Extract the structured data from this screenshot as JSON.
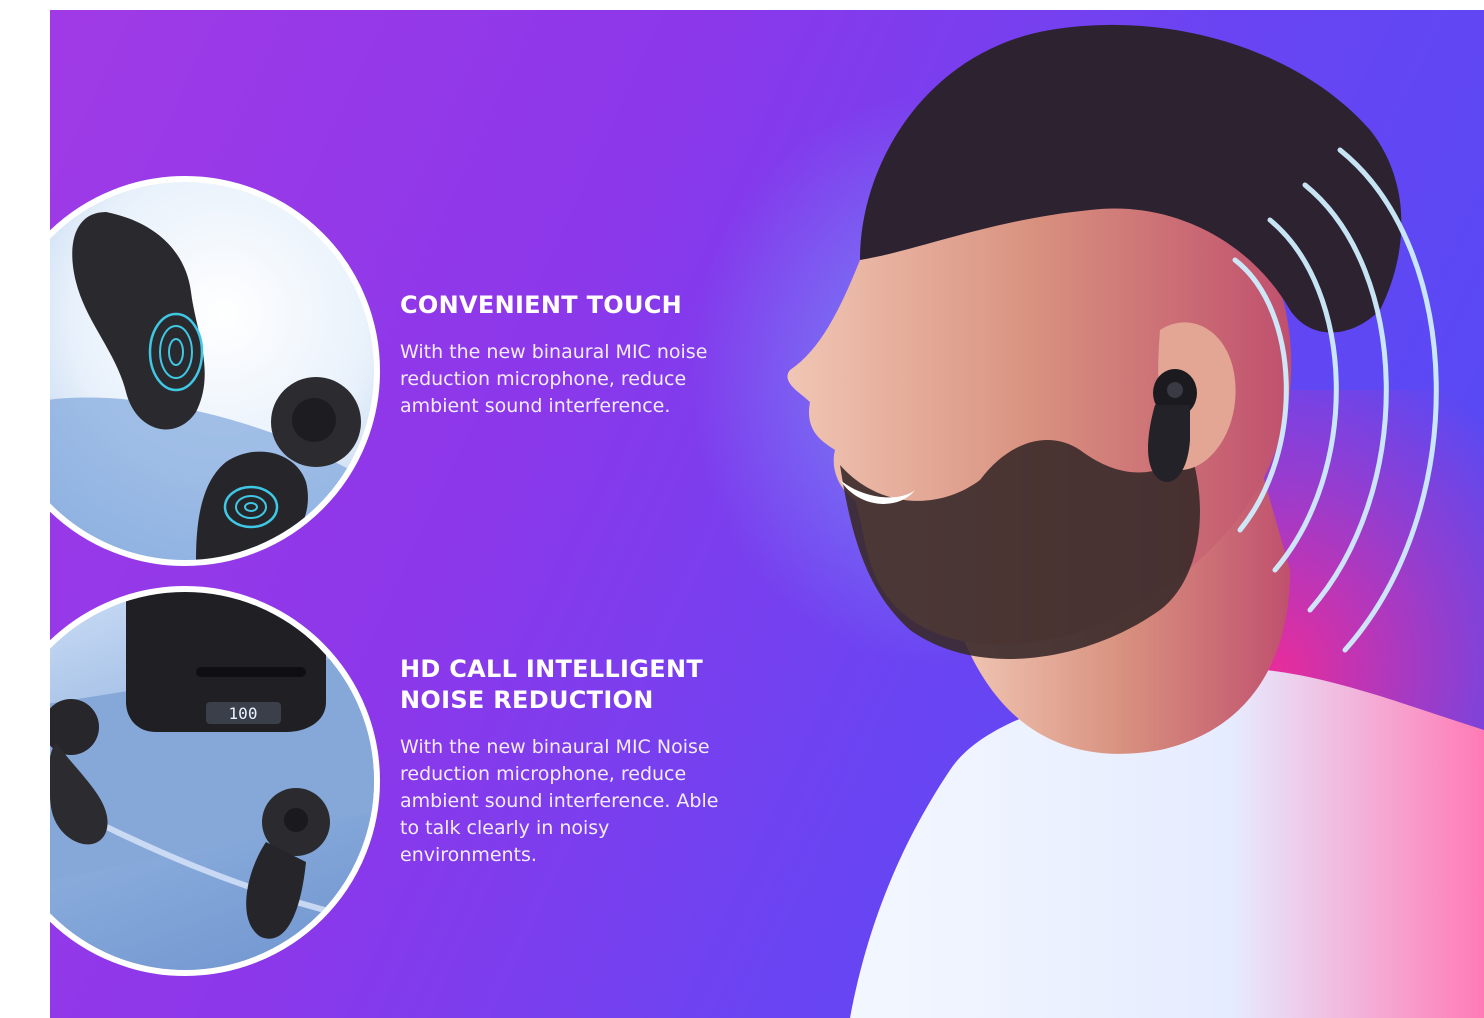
{
  "features": [
    {
      "heading": "CONVENIENT TOUCH",
      "body": "With the new binaural MIC noise reduction microphone, reduce ambient sound interference."
    },
    {
      "heading": "HD CALL INTELLIGENT NOISE REDUCTION",
      "body": "With the new binaural MIC Noise reduction microphone, reduce ambient sound interference. Able to talk clearly in noisy environments."
    }
  ],
  "case_display": "100",
  "colors": {
    "accent": "#8b38ea",
    "glow": "#ff2a8c",
    "wave": "#cfefff"
  }
}
